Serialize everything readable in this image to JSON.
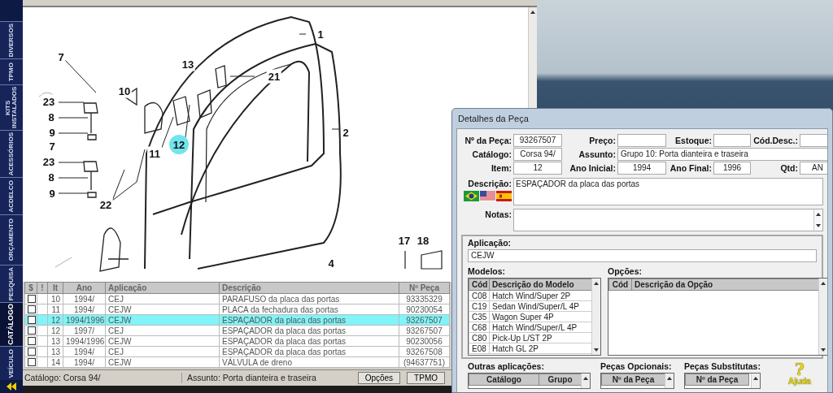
{
  "side_tabs": [
    {
      "label": "VEÍCULO",
      "selected": false
    },
    {
      "label": "CATÁLOGO",
      "selected": true
    },
    {
      "label": "PESQUISA",
      "selected": false
    },
    {
      "label": "ORÇAMENTO",
      "selected": false
    },
    {
      "label": "ACDELCO",
      "selected": false
    },
    {
      "label": "ACESSÓRIOS",
      "selected": false
    },
    {
      "label": "KITS INSTALADOS",
      "selected": false
    },
    {
      "label": "TPMO",
      "selected": false
    },
    {
      "label": "DIVERSOS",
      "selected": false
    }
  ],
  "diagram": {
    "callouts": [
      {
        "label": "1",
        "selected": false
      },
      {
        "label": "7",
        "selected": false
      },
      {
        "label": "13",
        "selected": false
      },
      {
        "label": "21",
        "selected": false
      },
      {
        "label": "10",
        "selected": false
      },
      {
        "label": "23",
        "selected": false
      },
      {
        "label": "8",
        "selected": false
      },
      {
        "label": "9",
        "selected": false
      },
      {
        "label": "11",
        "selected": false
      },
      {
        "label": "12",
        "selected": true
      },
      {
        "label": "2",
        "selected": false
      },
      {
        "label": "7",
        "selected": false
      },
      {
        "label": "23",
        "selected": false
      },
      {
        "label": "8",
        "selected": false
      },
      {
        "label": "9",
        "selected": false
      },
      {
        "label": "22",
        "selected": false
      },
      {
        "label": "17",
        "selected": false
      },
      {
        "label": "18",
        "selected": false
      },
      {
        "label": "4",
        "selected": false
      }
    ]
  },
  "parts_table": {
    "columns": [
      "$",
      "!",
      "It",
      "Ano",
      "Aplicação",
      "Descrição",
      "Nº Peça"
    ],
    "rows": [
      {
        "checked": false,
        "selected": false,
        "cells": [
          "",
          "",
          "10",
          "1994/",
          "CEJ",
          "PARAFUSO da placa das portas",
          "93335329"
        ]
      },
      {
        "checked": false,
        "selected": false,
        "cells": [
          "",
          "",
          "11",
          "1994/",
          "CEJW",
          "PLACA da fechadura das portas",
          "90230054"
        ]
      },
      {
        "checked": false,
        "selected": true,
        "cells": [
          "",
          "",
          "12",
          "1994/1996",
          "CEJW",
          "ESPAÇADOR da placa das portas",
          "93267507"
        ]
      },
      {
        "checked": false,
        "selected": false,
        "cells": [
          "",
          "",
          "12",
          "1997/",
          "CEJ",
          "ESPAÇADOR da placa das portas",
          "93267507"
        ]
      },
      {
        "checked": false,
        "selected": false,
        "cells": [
          "",
          "",
          "13",
          "1994/1996",
          "CEJW",
          "ESPAÇADOR da placa das portas",
          "90230056"
        ]
      },
      {
        "checked": false,
        "selected": false,
        "cells": [
          "",
          "",
          "13",
          "1994/",
          "CEJ",
          "ESPAÇADOR da placa das portas",
          "93267508"
        ]
      },
      {
        "checked": false,
        "selected": false,
        "cells": [
          "",
          "",
          "14",
          "1994/",
          "CEJW",
          "VÁLVULA de dreno",
          "(94637751)"
        ]
      }
    ]
  },
  "status_bar": {
    "catalog": "Catálogo: Corsa 94/",
    "subject": "Assunto: Porta dianteira e traseira",
    "buttons": [
      "Opções",
      "TPMO"
    ]
  },
  "details_dialog": {
    "title": "Detalhes da Peça",
    "field_rows": [
      [
        {
          "label": "Nº da Peça:",
          "value": "93267507"
        },
        {
          "label": "Preço:"
        },
        {
          "label": "Estoque:"
        },
        {
          "label": "Cód.Desc.:"
        }
      ],
      [
        {
          "label": "Catálogo:",
          "value": "Corsa 94/"
        },
        {
          "label": "Assunto:",
          "value": "Grupo 10: Porta dianteira e traseira"
        }
      ],
      [
        {
          "label": "Item:",
          "value": "12"
        },
        {
          "label": "Ano Inicial:",
          "value": "1994"
        },
        {
          "label": "Ano Final:",
          "value": "1996"
        },
        {
          "label": "Qtd:",
          "value": "AN"
        }
      ]
    ],
    "description": {
      "label": "Descrição:",
      "value": "ESPAÇADOR da placa das portas"
    },
    "notes": {
      "label": "Notas:"
    },
    "application": {
      "label": "Aplicação:",
      "value": "CEJW"
    },
    "models": {
      "label": "Modelos:",
      "columns": [
        "Cód",
        "Descrição do Modelo"
      ],
      "rows": [
        [
          "C08",
          "Hatch Wind/Super 2P"
        ],
        [
          "C19",
          "Sedan Wind/Super/L 4P"
        ],
        [
          "C35",
          "Wagon Super 4P"
        ],
        [
          "C68",
          "Hatch Wind/Super/L 4P"
        ],
        [
          "C80",
          "Pick-Up L/ST 2P"
        ],
        [
          "E08",
          "Hatch GL 2P"
        ]
      ]
    },
    "options": {
      "label": "Opções:",
      "columns": [
        "Cód",
        "Descrição da Opção"
      ]
    },
    "other_applications": {
      "label": "Outras aplicações:",
      "columns": [
        "Catálogo",
        "Grupo"
      ]
    },
    "optional_parts": {
      "label": "Peças Opcionais:",
      "columns": [
        "Nº da Peça"
      ]
    },
    "substitute_parts": {
      "label": "Peças Substitutas:",
      "columns": [
        "Nº da Peça"
      ]
    },
    "help": {
      "glyph": "?",
      "label": "Ajuda"
    }
  }
}
